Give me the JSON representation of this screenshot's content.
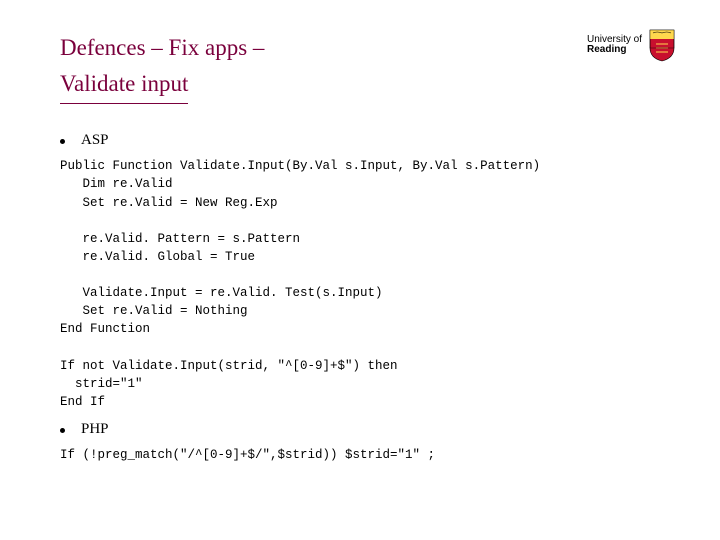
{
  "title": {
    "line1": "Defences – Fix apps –",
    "line2": "Validate input"
  },
  "logo": {
    "top": "University of",
    "bottom": "Reading"
  },
  "bullets": {
    "asp": "ASP",
    "php": "PHP"
  },
  "code": {
    "asp": "Public Function Validate.Input(By.Val s.Input, By.Val s.Pattern)\n   Dim re.Valid\n   Set re.Valid = New Reg.Exp\n\n   re.Valid. Pattern = s.Pattern\n   re.Valid. Global = True\n\n   Validate.Input = re.Valid. Test(s.Input)\n   Set re.Valid = Nothing\nEnd Function\n\nIf not Validate.Input(strid, \"^[0-9]+$\") then\n  strid=\"1\"\nEnd If",
    "php": "If (!preg_match(\"/^[0-9]+$/\",$strid)) $strid=\"1\" ;"
  }
}
